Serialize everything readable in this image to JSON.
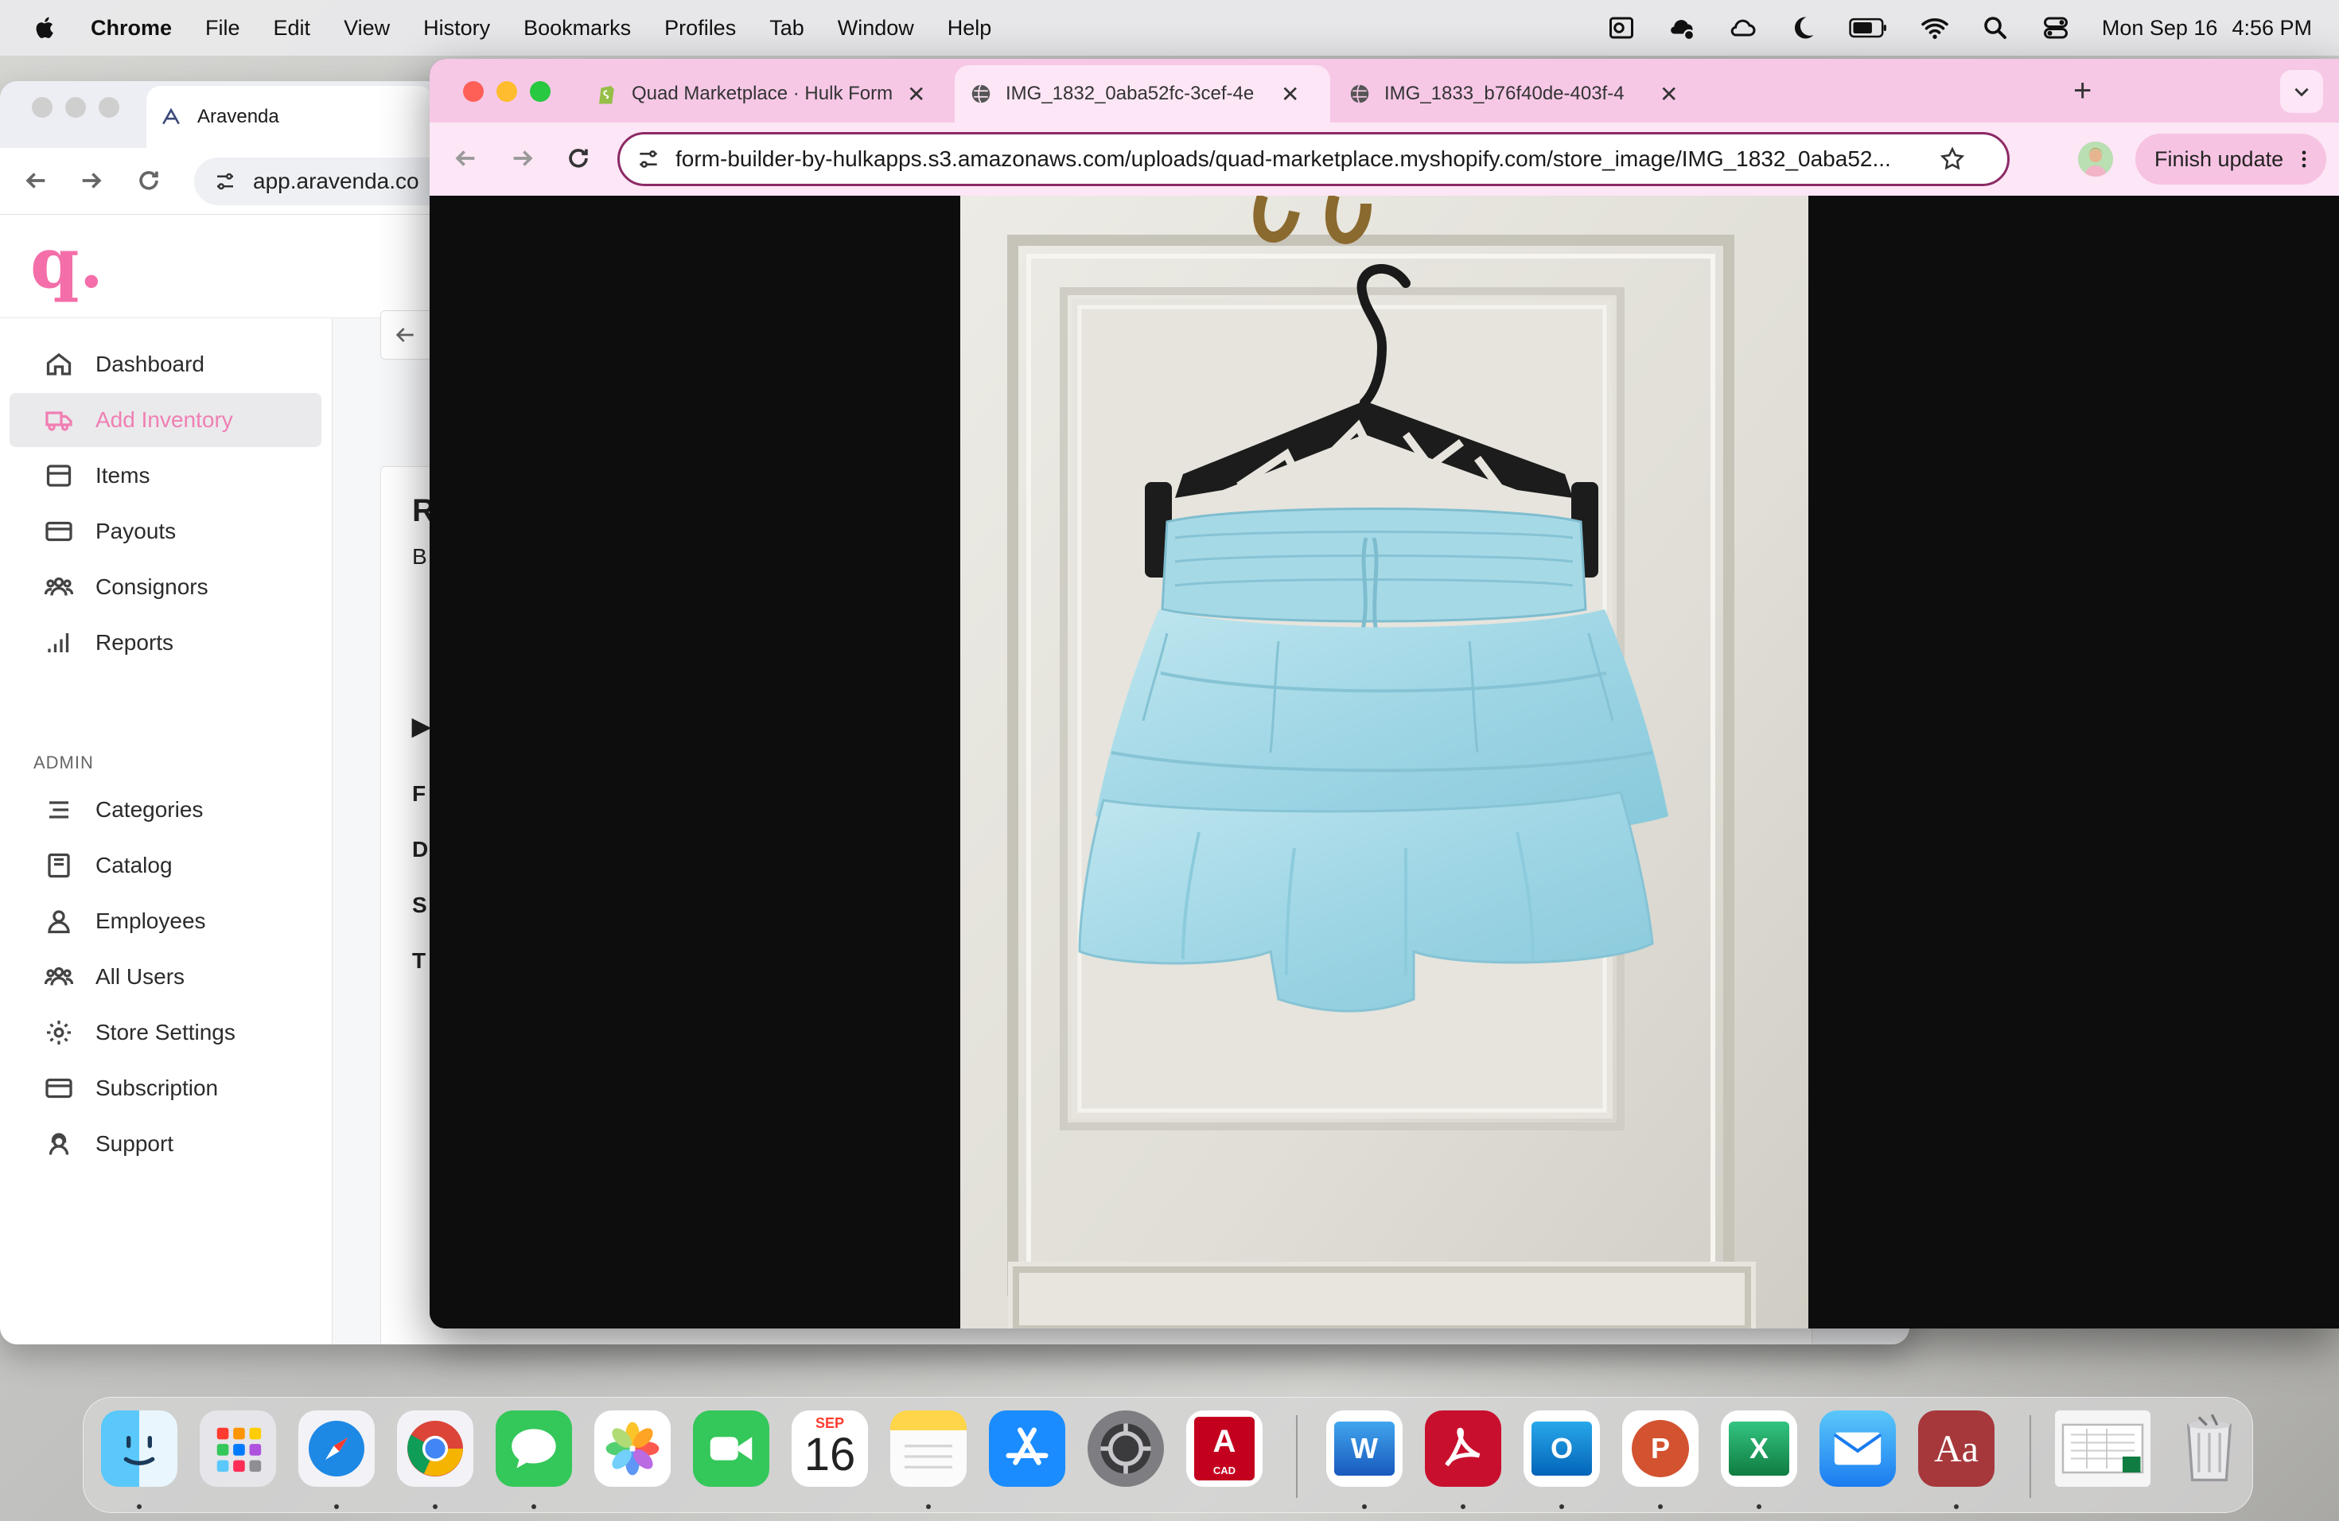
{
  "menubar": {
    "app_name": "Chrome",
    "items": [
      "File",
      "Edit",
      "View",
      "History",
      "Bookmarks",
      "Profiles",
      "Tab",
      "Window",
      "Help"
    ],
    "date": "Mon Sep 16",
    "time": "4:56 PM"
  },
  "back_window": {
    "tab_title": "Aravenda",
    "url": "app.aravenda.co",
    "logo": "q.",
    "sidebar": {
      "items": [
        {
          "label": "Dashboard",
          "icon": "home-icon"
        },
        {
          "label": "Add Inventory",
          "icon": "truck-icon",
          "active": true
        },
        {
          "label": "Items",
          "icon": "box-icon"
        },
        {
          "label": "Payouts",
          "icon": "card-icon"
        },
        {
          "label": "Consignors",
          "icon": "users-icon"
        },
        {
          "label": "Reports",
          "icon": "bar-chart-icon"
        }
      ],
      "section_label": "ADMIN",
      "admin_items": [
        {
          "label": "Categories",
          "icon": "list-icon"
        },
        {
          "label": "Catalog",
          "icon": "book-icon"
        },
        {
          "label": "Employees",
          "icon": "user-icon"
        },
        {
          "label": "All Users",
          "icon": "users-icon"
        },
        {
          "label": "Store Settings",
          "icon": "gear-icon"
        },
        {
          "label": "Subscription",
          "icon": "card-icon"
        },
        {
          "label": "Support",
          "icon": "support-icon"
        }
      ]
    },
    "peek": [
      "R",
      "B",
      "▶",
      "F",
      "D",
      "S",
      "T"
    ]
  },
  "front_window": {
    "tabs": [
      {
        "title": "Quad Marketplace · Hulk Form",
        "icon": "shopify-icon"
      },
      {
        "title": "IMG_1832_0aba52fc-3cef-4e",
        "icon": "globe-icon",
        "active": true
      },
      {
        "title": "IMG_1833_b76f40de-403f-4",
        "icon": "globe-icon"
      }
    ],
    "url": "form-builder-by-hulkapps.s3.amazonaws.com/uploads/quad-marketplace.myshopify.com/store_image/IMG_1832_0aba52...",
    "finish_update": "Finish update"
  },
  "dock": {
    "calendar_month": "SEP",
    "calendar_day": "16",
    "apps": [
      "finder",
      "launchpad",
      "safari",
      "chrome",
      "messages",
      "photos",
      "facetime",
      "calendar",
      "notes",
      "app-store",
      "system-settings",
      "autocad",
      "word",
      "acrobat",
      "outlook",
      "powerpoint",
      "excel",
      "mail",
      "dictionary",
      "downloads",
      "trash"
    ]
  },
  "colors": {
    "accent_pink": "#f07fb3",
    "tab_strip": "#f6c8e6",
    "omnibox_border": "#8c2a66",
    "skirt": "#a8dbe8"
  }
}
